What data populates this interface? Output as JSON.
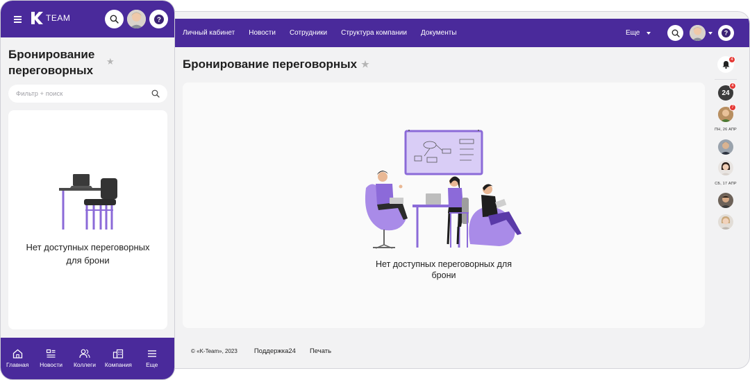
{
  "desktop": {
    "nav": [
      "Личный кабинет",
      "Новости",
      "Сотрудники",
      "Структура компании",
      "Документы"
    ],
    "more_label": "Еще",
    "page_title": "Бронирование переговорных",
    "empty_text": "Нет доступных переговорных для брони",
    "footer": {
      "copyright": "© «K-Team», 2023",
      "support": "Поддержка24",
      "print": "Печать"
    },
    "rail": {
      "bell_badge": "4",
      "b24_label": "24",
      "b24_badge": "4",
      "avatar_badge": "7",
      "date1": "ПН, 26 АПР",
      "date2": "СБ, 17 АПР"
    }
  },
  "mobile": {
    "logo_text": "TEAM",
    "page_title": "Бронирование переговорных",
    "search_placeholder": "Фильтр + поиск",
    "empty_text": "Нет доступных переговорных для брони",
    "tabs": [
      "Главная",
      "Новости",
      "Коллеги",
      "Компания",
      "Еще"
    ]
  },
  "colors": {
    "brand": "#4a2a9b",
    "accent_light": "#a88be6",
    "badge": "#e53935"
  }
}
